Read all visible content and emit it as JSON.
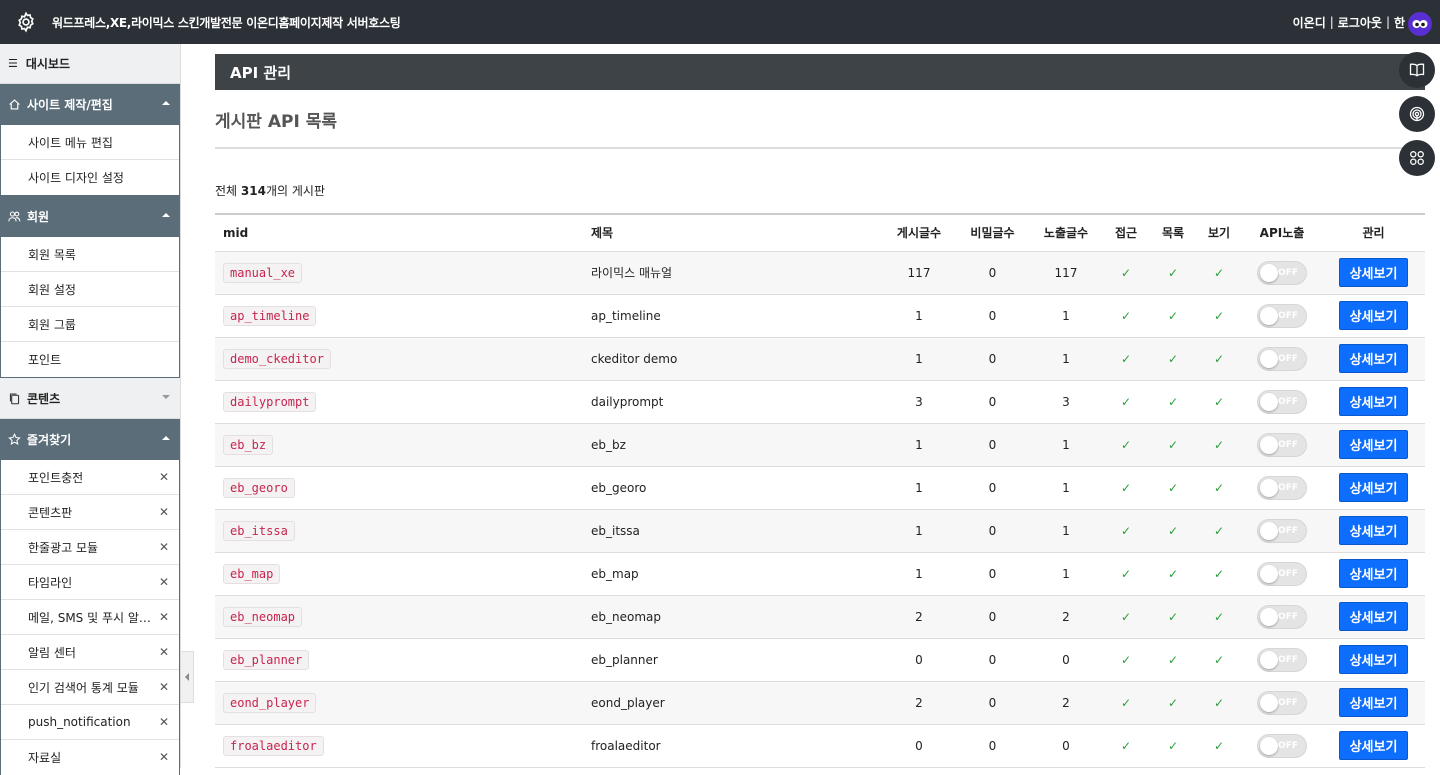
{
  "topbar": {
    "title": "워드프레스,XE,라이믹스 스킨개발전문 이온디홈페이지제작 서버호스팅",
    "user": "이온디",
    "logout": "로그아웃",
    "extra": "한",
    "sep": "|"
  },
  "sidebar": {
    "dashboard": "대시보드",
    "sections": [
      {
        "label": "사이트 제작/편집",
        "items": [
          "사이트 메뉴 편집",
          "사이트 디자인 설정"
        ]
      },
      {
        "label": "회원",
        "items": [
          "회원 목록",
          "회원 설정",
          "회원 그룹",
          "포인트"
        ]
      },
      {
        "label": "콘텐츠"
      },
      {
        "label": "즐겨찾기",
        "items": [
          "포인트충전",
          "콘텐츠판",
          "한줄광고 모듈",
          "타임라인",
          "메일, SMS 및 푸시 알림 관리",
          "알림 센터",
          "인기 검색어 통계 모듈",
          "push_notification",
          "자료실"
        ]
      }
    ]
  },
  "main": {
    "page_title": "API 관리",
    "sub_title": "게시판 API 목록",
    "count_prefix": "전체",
    "count_value": "314",
    "count_suffix": "개의 게시판",
    "columns": [
      "mid",
      "제목",
      "게시글수",
      "비밀글수",
      "노출글수",
      "접근",
      "목록",
      "보기",
      "API노출",
      "관리"
    ],
    "check": "✓",
    "toggle_label": "OFF",
    "detail_button": "상세보기",
    "rows": [
      {
        "mid": "manual_xe",
        "title": "라이믹스 매뉴얼",
        "posts": "117",
        "secret": "0",
        "visible": "117"
      },
      {
        "mid": "ap_timeline",
        "title": "ap_timeline",
        "posts": "1",
        "secret": "0",
        "visible": "1"
      },
      {
        "mid": "demo_ckeditor",
        "title": "ckeditor demo",
        "posts": "1",
        "secret": "0",
        "visible": "1"
      },
      {
        "mid": "dailyprompt",
        "title": "dailyprompt",
        "posts": "3",
        "secret": "0",
        "visible": "3"
      },
      {
        "mid": "eb_bz",
        "title": "eb_bz",
        "posts": "1",
        "secret": "0",
        "visible": "1"
      },
      {
        "mid": "eb_georo",
        "title": "eb_georo",
        "posts": "1",
        "secret": "0",
        "visible": "1"
      },
      {
        "mid": "eb_itssa",
        "title": "eb_itssa",
        "posts": "1",
        "secret": "0",
        "visible": "1"
      },
      {
        "mid": "eb_map",
        "title": "eb_map",
        "posts": "1",
        "secret": "0",
        "visible": "1"
      },
      {
        "mid": "eb_neomap",
        "title": "eb_neomap",
        "posts": "2",
        "secret": "0",
        "visible": "2"
      },
      {
        "mid": "eb_planner",
        "title": "eb_planner",
        "posts": "0",
        "secret": "0",
        "visible": "0"
      },
      {
        "mid": "eond_player",
        "title": "eond_player",
        "posts": "2",
        "secret": "0",
        "visible": "2"
      },
      {
        "mid": "froalaeditor",
        "title": "froalaeditor",
        "posts": "0",
        "secret": "0",
        "visible": "0"
      }
    ]
  },
  "colors": {
    "topbar": "#2b3136",
    "sidebar_head": "#5b6d79",
    "button": "#0d6efd",
    "check": "#2a9d3a"
  },
  "icons": [
    "gear-icon",
    "menu-icon",
    "home-icon",
    "users-icon",
    "copy-icon",
    "star-icon",
    "close-icon",
    "book-icon",
    "broadcast-icon",
    "grid-icon",
    "avatar-icon"
  ]
}
